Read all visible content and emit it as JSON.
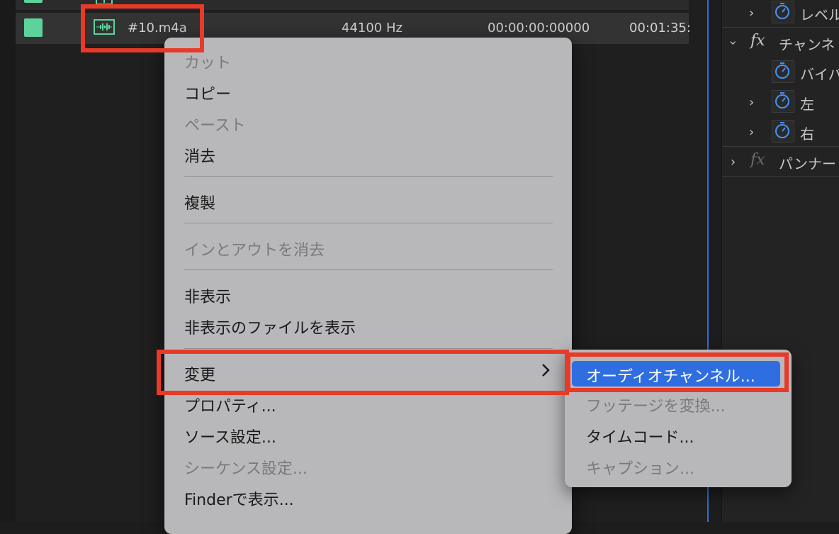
{
  "project_panel": {
    "rows": [
      {
        "name": "",
        "rate": "",
        "start": "",
        "end": ""
      },
      {
        "name": "#10.m4a",
        "rate": "44100 Hz",
        "start": "00:00:00:00000",
        "end": "00:01:35:"
      }
    ]
  },
  "effects_panel": {
    "items": [
      {
        "label": "レベル",
        "type": "param"
      },
      {
        "label": "チャンネ",
        "type": "fx"
      },
      {
        "label": "バイパ",
        "type": "param"
      },
      {
        "label": "左",
        "type": "param"
      },
      {
        "label": "右",
        "type": "param"
      },
      {
        "label": "パンナー",
        "type": "fx"
      }
    ]
  },
  "context_menu": {
    "items": [
      {
        "label": "カット",
        "enabled": false
      },
      {
        "label": "コピー",
        "enabled": true
      },
      {
        "label": "ペースト",
        "enabled": false
      },
      {
        "label": "消去",
        "enabled": true
      },
      {
        "label": "複製",
        "enabled": true
      },
      {
        "label": "インとアウトを消去",
        "enabled": false
      },
      {
        "label": "非表示",
        "enabled": true
      },
      {
        "label": "非表示のファイルを表示",
        "enabled": true
      },
      {
        "label": "変更",
        "enabled": true,
        "submenu": true
      },
      {
        "label": "プロパティ...",
        "enabled": true
      },
      {
        "label": "ソース設定...",
        "enabled": true
      },
      {
        "label": "シーケンス設定...",
        "enabled": false
      },
      {
        "label": "Finderで表示...",
        "enabled": true
      }
    ]
  },
  "submenu": {
    "items": [
      {
        "label": "オーディオチャンネル...",
        "enabled": true,
        "highlighted": true
      },
      {
        "label": "フッテージを変換...",
        "enabled": false
      },
      {
        "label": "タイムコード...",
        "enabled": true
      },
      {
        "label": "キャプション...",
        "enabled": false
      }
    ]
  },
  "icons": {
    "audio_clip": "audio-waveform-icon",
    "submenu_arrow": "chevron-right-icon",
    "stopwatch": "stopwatch-icon",
    "fx": "fx-icon",
    "expand": "chevron-icon"
  },
  "colors": {
    "highlight": "#2f6ee0",
    "annotation": "#e83a28",
    "label_swatch": "#5dd39b",
    "accent_line": "#2e6fd8"
  }
}
